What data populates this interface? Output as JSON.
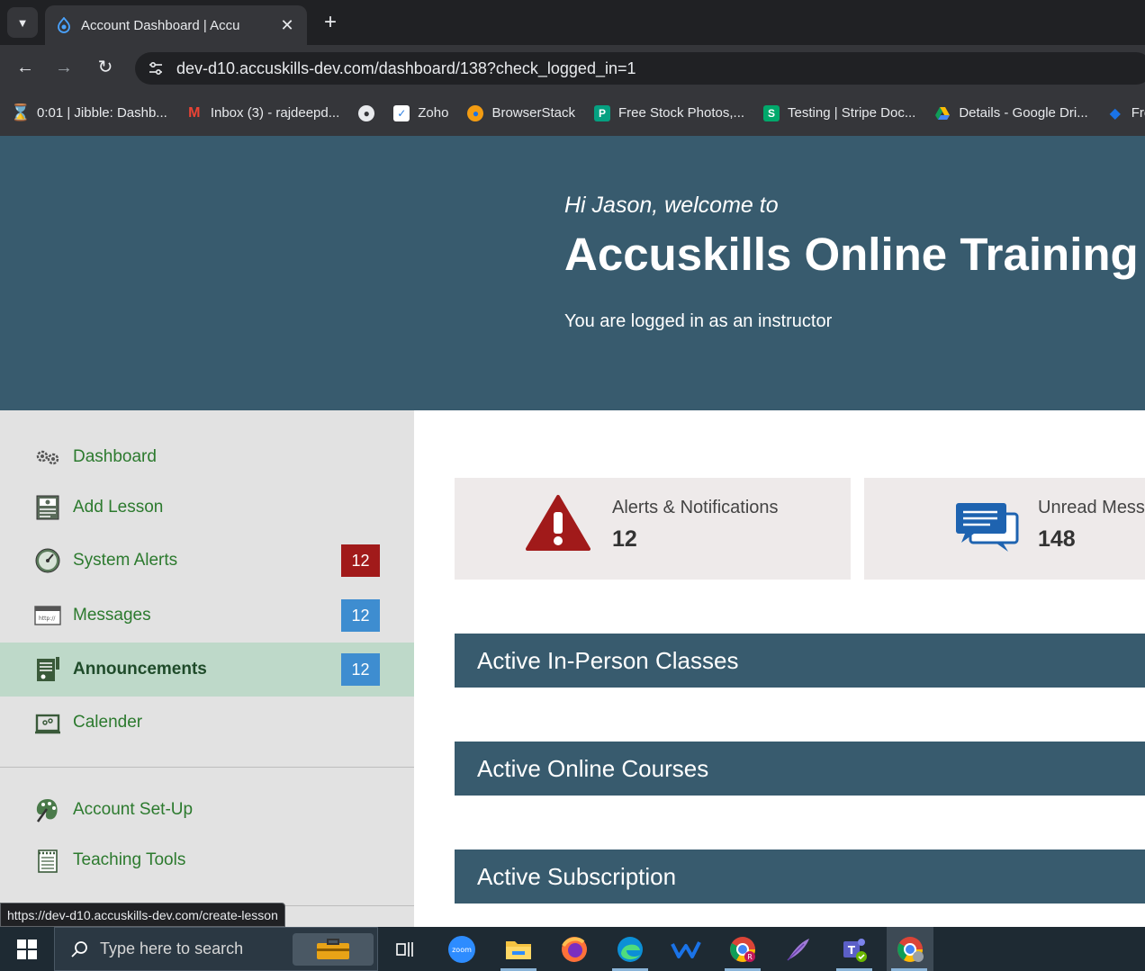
{
  "browser": {
    "tab_title": "Account Dashboard | Accu",
    "url": "dev-d10.accuskills-dev.com/dashboard/138?check_logged_in=1",
    "bookmarks": [
      {
        "label": "0:01 | Jibble: Dashb...",
        "icon": "hourglass-icon",
        "color": "#f4511e"
      },
      {
        "label": "Inbox (3) - rajdeepd...",
        "icon": "gmail-icon",
        "color": "#ea4335"
      },
      {
        "label": "",
        "icon": "globe-icon",
        "color": "#e8eaed"
      },
      {
        "label": "Zoho",
        "icon": "zoho-icon",
        "color": "#ffffff"
      },
      {
        "label": "BrowserStack",
        "icon": "browserstack-icon",
        "color": "#f39c12"
      },
      {
        "label": "Free Stock Photos,...",
        "icon": "pexels-icon",
        "color": "#05a081"
      },
      {
        "label": "Testing | Stripe Doc...",
        "icon": "stripe-icon",
        "color": "#00a86b"
      },
      {
        "label": "Details - Google Dri...",
        "icon": "google-drive-icon",
        "color": "#fbbc04"
      },
      {
        "label": "Free V",
        "icon": "diamond-icon",
        "color": "#1a73e8"
      }
    ]
  },
  "hero": {
    "greeting": "Hi Jason, welcome to",
    "title": "Accuskills Online Training",
    "role": "You are logged in as an instructor"
  },
  "sidebar": {
    "items": [
      {
        "label": "Dashboard",
        "icon": "gears-icon",
        "badge": ""
      },
      {
        "label": "Add Lesson",
        "icon": "lesson-icon",
        "badge": ""
      },
      {
        "label": "System Alerts",
        "icon": "gauge-icon",
        "badge": "12",
        "badge_color": "#a11a1a"
      },
      {
        "label": "Messages",
        "icon": "browser-window-icon",
        "badge": "12",
        "badge_color": "#3e8dd0"
      },
      {
        "label": "Announcements",
        "icon": "announcement-icon",
        "badge": "12",
        "badge_color": "#3e8dd0"
      },
      {
        "label": "Calender",
        "icon": "calendar-icon",
        "badge": ""
      },
      {
        "label": "Account Set-Up",
        "icon": "palette-icon",
        "badge": ""
      },
      {
        "label": "Teaching Tools",
        "icon": "notepad-icon",
        "badge": ""
      }
    ]
  },
  "cards": {
    "alerts": {
      "label": "Alerts & Notifications",
      "value": "12",
      "icon": "warning-icon",
      "color": "#a11a1a"
    },
    "messages": {
      "label": "Unread Mess",
      "value": "148",
      "icon": "chat-bubbles-icon",
      "color": "#1e63b0"
    }
  },
  "sections": [
    {
      "title": "Active In-Person Classes"
    },
    {
      "title": "Active Online Courses"
    },
    {
      "title": "Active Subscription"
    }
  ],
  "status_url": "https://dev-d10.accuskills-dev.com/create-lesson",
  "taskbar": {
    "search_placeholder": "Type here to search",
    "apps": [
      "task-view-icon",
      "zoom-icon",
      "file-explorer-icon",
      "firefox-icon",
      "edge-icon",
      "wrike-icon",
      "chrome-profile-icon",
      "feather-icon",
      "teams-icon",
      "chrome-icon"
    ]
  },
  "colors": {
    "hero_bg": "#385b6e",
    "sidebar_bg": "#e2e2e2",
    "sidebar_active": "#bed9c9",
    "link_green": "#2c7a2e"
  }
}
